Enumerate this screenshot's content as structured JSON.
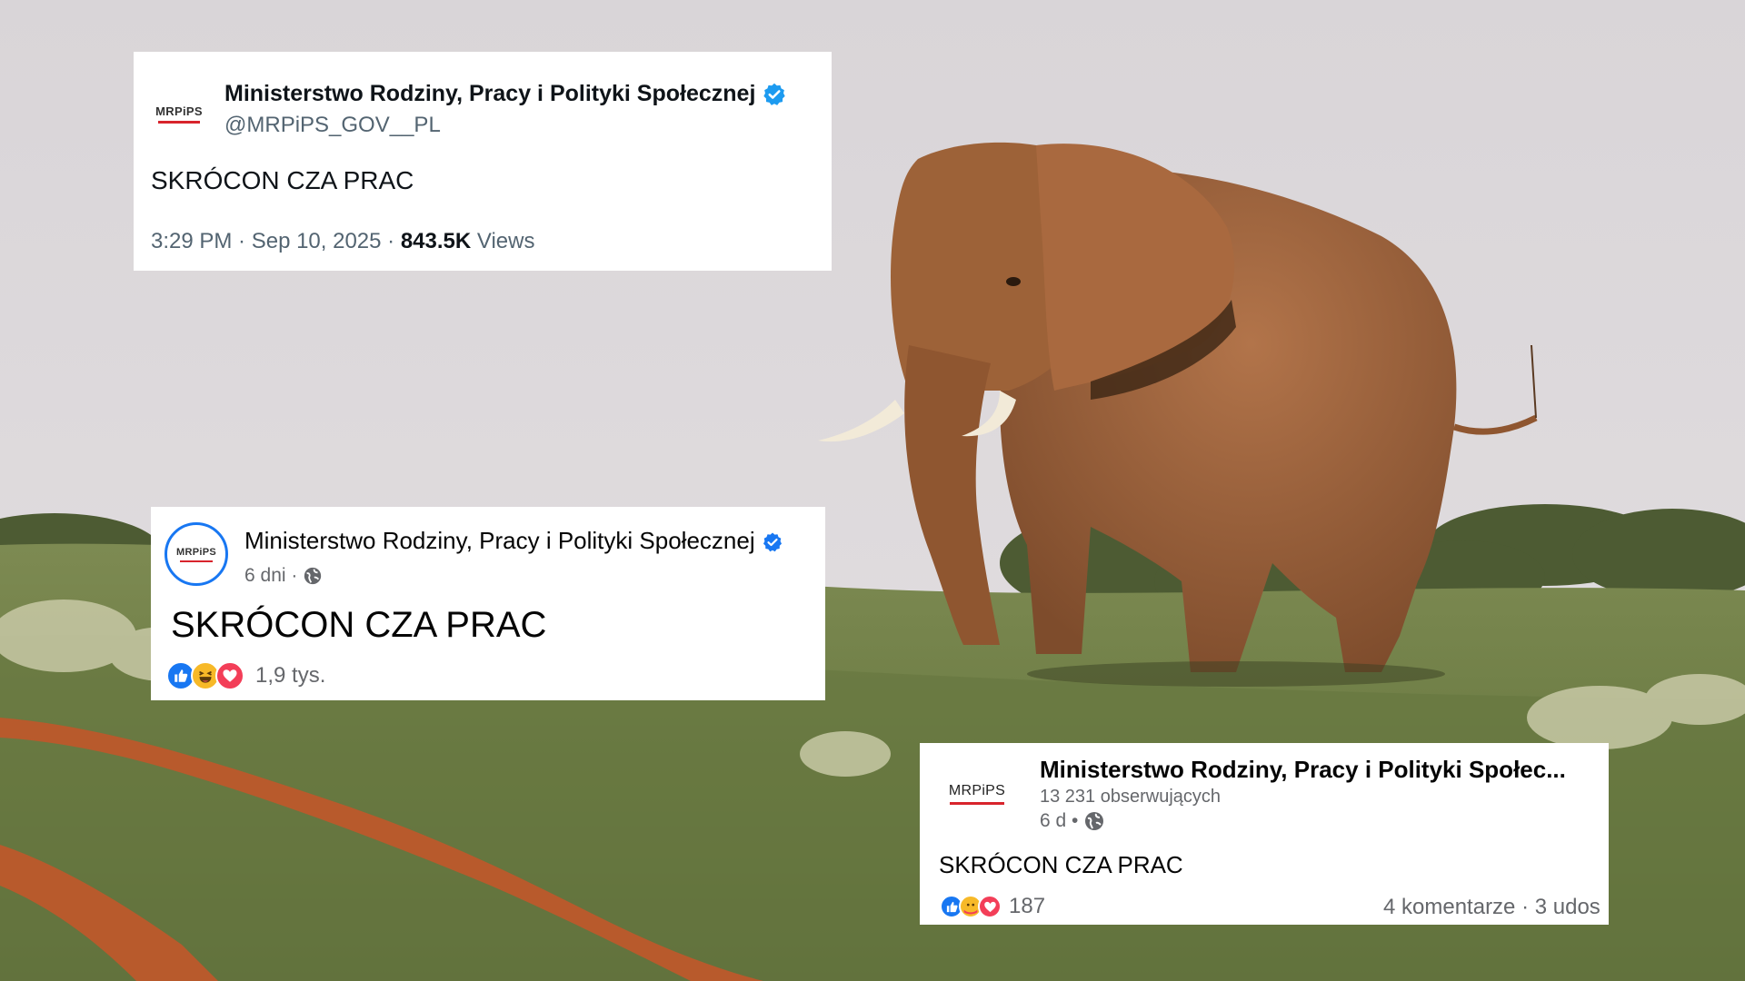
{
  "x_post": {
    "logo_text": "MRPiPS",
    "author": "Ministerstwo Rodziny, Pracy i Polityki Społecznej",
    "handle": "@MRPiPS_GOV__PL",
    "body": "SKRÓCON CZA PRAC",
    "time": "3:29 PM · Sep 10, 2025 · ",
    "views_count": "843.5K",
    "views_label": " Views"
  },
  "fb_post_1": {
    "logo_text": "MRPiPS",
    "author": "Ministerstwo Rodziny, Pracy i Polityki Społecznej",
    "age": "6 dni · ",
    "body": "SKRÓCON CZA PRAC",
    "reaction_count": "1,9 tys.",
    "reactions": [
      "like-icon",
      "haha-icon",
      "love-icon"
    ]
  },
  "fb_post_2": {
    "logo_text": "MRPiPS",
    "author": "Ministerstwo Rodziny, Pracy i Polityki Społec...",
    "followers": "13 231 obserwujących",
    "age": "6 d • ",
    "body": "SKRÓCON CZA PRAC",
    "reaction_count": "187",
    "stats": "4 komentarze · 3 udos",
    "reactions": [
      "like-icon",
      "care-icon",
      "love-icon"
    ]
  },
  "colors": {
    "x_verified": "#1d9bf0",
    "fb_verified": "#1877f2",
    "logo_red": "#d8242c",
    "elephant": "#a0653e",
    "sky": "#dcd8da",
    "grass": "#6f7f46"
  }
}
